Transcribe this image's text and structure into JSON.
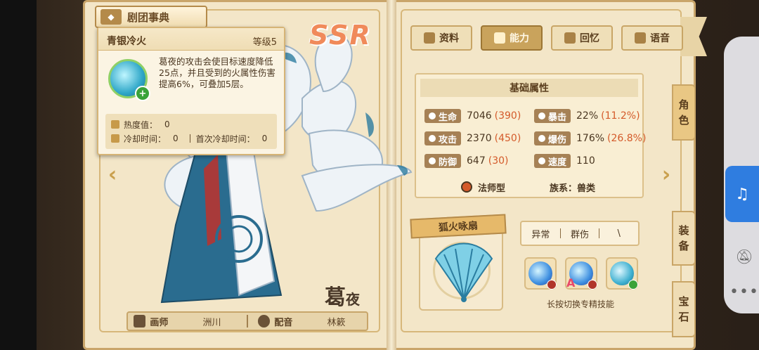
{
  "header": {
    "title": "剧团事典"
  },
  "character": {
    "rarity": "SSR",
    "name_big": "葛",
    "name_small": "夜"
  },
  "credits": {
    "artist_label": "画师",
    "artist": "洲川",
    "voice_label": "配音",
    "voice": "林簌"
  },
  "tooltip": {
    "skill_name": "青银冷火",
    "level": "等级5",
    "description": "葛夜的攻击会使目标速度降低25点，并且受到的火属性伤害提高6%，可叠加5层。",
    "heat_label": "热度值：",
    "heat_value": "0",
    "cooldown_label": "冷却时间：",
    "cooldown_value": "0",
    "first_cooldown_label": "首次冷却时间：",
    "first_cooldown_value": "0"
  },
  "tabs": [
    {
      "label": "资料"
    },
    {
      "label": "能力",
      "active": true
    },
    {
      "label": "回忆"
    },
    {
      "label": "语音"
    }
  ],
  "attributes": {
    "title": "基础属性",
    "hp": {
      "label": "生命",
      "base": "7046",
      "bonus": "(390)"
    },
    "crit": {
      "label": "暴击",
      "base": "22%",
      "bonus": "(11.2%)"
    },
    "atk": {
      "label": "攻击",
      "base": "2370",
      "bonus": "(450)"
    },
    "critdmg": {
      "label": "爆伤",
      "base": "176%",
      "bonus": "(26.8%)"
    },
    "def": {
      "label": "防御",
      "base": "647",
      "bonus": "(30)"
    },
    "spd": {
      "label": "速度",
      "base": "110",
      "bonus": ""
    },
    "class": "法师型",
    "race": "族系：兽类"
  },
  "weapon": {
    "name": "狐火咏扇"
  },
  "skills": {
    "tags": [
      "异常",
      "群伤",
      "\\"
    ],
    "hint": "长按切换专精技能"
  },
  "side_tabs": [
    "角色",
    "装备",
    "宝石"
  ],
  "colors": {
    "accent": "#c9a35c",
    "bonus": "#d45a2a",
    "system_blue": "#2f7de0"
  }
}
